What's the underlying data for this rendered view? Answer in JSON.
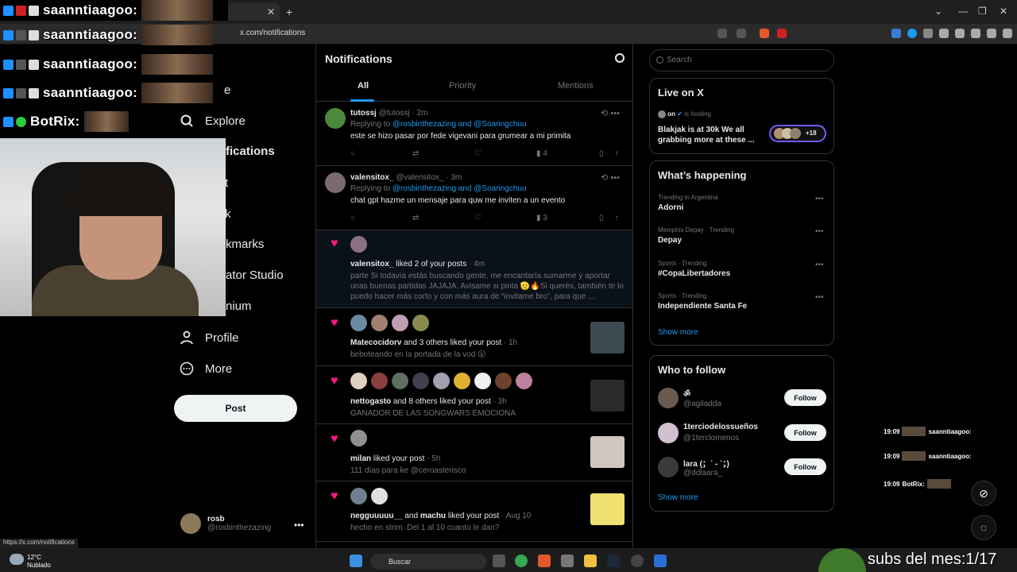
{
  "browser": {
    "url": "x.com/notifications",
    "status_url": "https://x.com/notifications"
  },
  "overlay_chat": {
    "lines": [
      {
        "name": "saanntiaagoo:"
      },
      {
        "name": "saanntiaagoo:"
      },
      {
        "name": "saanntiaagoo:"
      },
      {
        "name": "saanntiaagoo:"
      },
      {
        "name": "BotRix:"
      }
    ],
    "right_lines": [
      {
        "time": "19:09",
        "name": "saanntiaagoo:"
      },
      {
        "time": "19:09",
        "name": "saanntiaagoo:"
      },
      {
        "time": "19:09",
        "name": "BotRix:"
      }
    ],
    "subs": "subs del mes:1/17"
  },
  "nav": {
    "partial_item": "e",
    "explore": "Explore",
    "notifications_partial": "fications",
    "items_partial": [
      "t",
      "k"
    ],
    "bookmarks_partial": "kmarks",
    "creator_partial": "ator Studio",
    "premium_partial": "nium",
    "profile": "Profile",
    "more": "More",
    "post_button": "Post",
    "account_name": "rosb",
    "account_handle": "@rosbinthezazing"
  },
  "main": {
    "title": "Notifications",
    "tabs": [
      {
        "label": "All",
        "active": true
      },
      {
        "label": "Priority",
        "active": false
      },
      {
        "label": "Mentions",
        "active": false
      }
    ],
    "tweets": [
      {
        "name": "tutossj",
        "handle": "@tutossj",
        "time": "· 2m",
        "replying": "Replying to",
        "reply_to": "@rosbinthezazing and @Soaringchuu",
        "text": "este se hizo pasar por fede vigevani para grumear a mi primita",
        "views": "4"
      },
      {
        "name": "valensitox_",
        "handle": "@valensitox_",
        "time": "· 3m",
        "replying": "Replying to",
        "reply_to": "@rosbinthezazing and @Soaringchuu",
        "text": "chat gpt hazme un mensaje para quw me inviten a un evento",
        "views": "3"
      }
    ],
    "notifications": [
      {
        "name": "valensitox_",
        "action": " liked 2 of your posts",
        "time": " · 4m",
        "text": "parte Si todavía estás buscando gente, me encantaría sumarme y aportar unas buenas partidas JAJAJA. Avisame si pinta 🫡🔥Si querés, también te lo puedo hacer más corto y con más aura de “invitame bro”, para que ..."
      },
      {
        "name": "Matecocidorv",
        "action": " and 3 others liked your post",
        "time": " · 1h",
        "text": "beboteando en la portada de la vod 😮"
      },
      {
        "name": "nettogasto",
        "action": " and 8 others liked your post",
        "time": " · 3h",
        "text": "GANADOR DE LAS SONGWARS EMOCIONA"
      },
      {
        "name": "milan",
        "action": " liked your post",
        "time": " · 5h",
        "text": "111 días para ke @ceroasterisco"
      },
      {
        "name": "negguuuuu__",
        "action_mid": " and ",
        "name2": "machu",
        "action": " liked your post",
        "time": " · Aug 10",
        "text": "hecho en strim .Del 1 al 10 cuanto le dan?"
      }
    ]
  },
  "right": {
    "search_placeholder": "Search",
    "live": {
      "title": "Live on X",
      "host_prefix": "on",
      "host_suffix": "is hosting",
      "text": "Blakjak is at 30k We all grabbing more at these ...",
      "count": "+18"
    },
    "happening": {
      "title": "What’s happening",
      "trends": [
        {
          "context": "Trending in Argentina",
          "name": "Adorni"
        },
        {
          "context": "Memphis Depay · Trending",
          "name": "Depay"
        },
        {
          "context": "Sports · Trending",
          "name": "#CopaLibertadores"
        },
        {
          "context": "Sports · Trending",
          "name": "Independiente Santa Fe"
        }
      ],
      "show_more": "Show more"
    },
    "who_to_follow": {
      "title": "Who to follow",
      "accounts": [
        {
          "name": "ॐ",
          "handle": "@agiladda",
          "button": "Follow"
        },
        {
          "name": "1terciodelossueños",
          "handle": "@1terclomenos",
          "button": "Follow"
        },
        {
          "name": "lara (；´ - `；)",
          "handle": "@ddlaara_",
          "button": "Follow"
        }
      ],
      "show_more": "Show more"
    }
  },
  "taskbar": {
    "temp": "12°C",
    "weather": "Nublado",
    "search": "Buscar"
  }
}
